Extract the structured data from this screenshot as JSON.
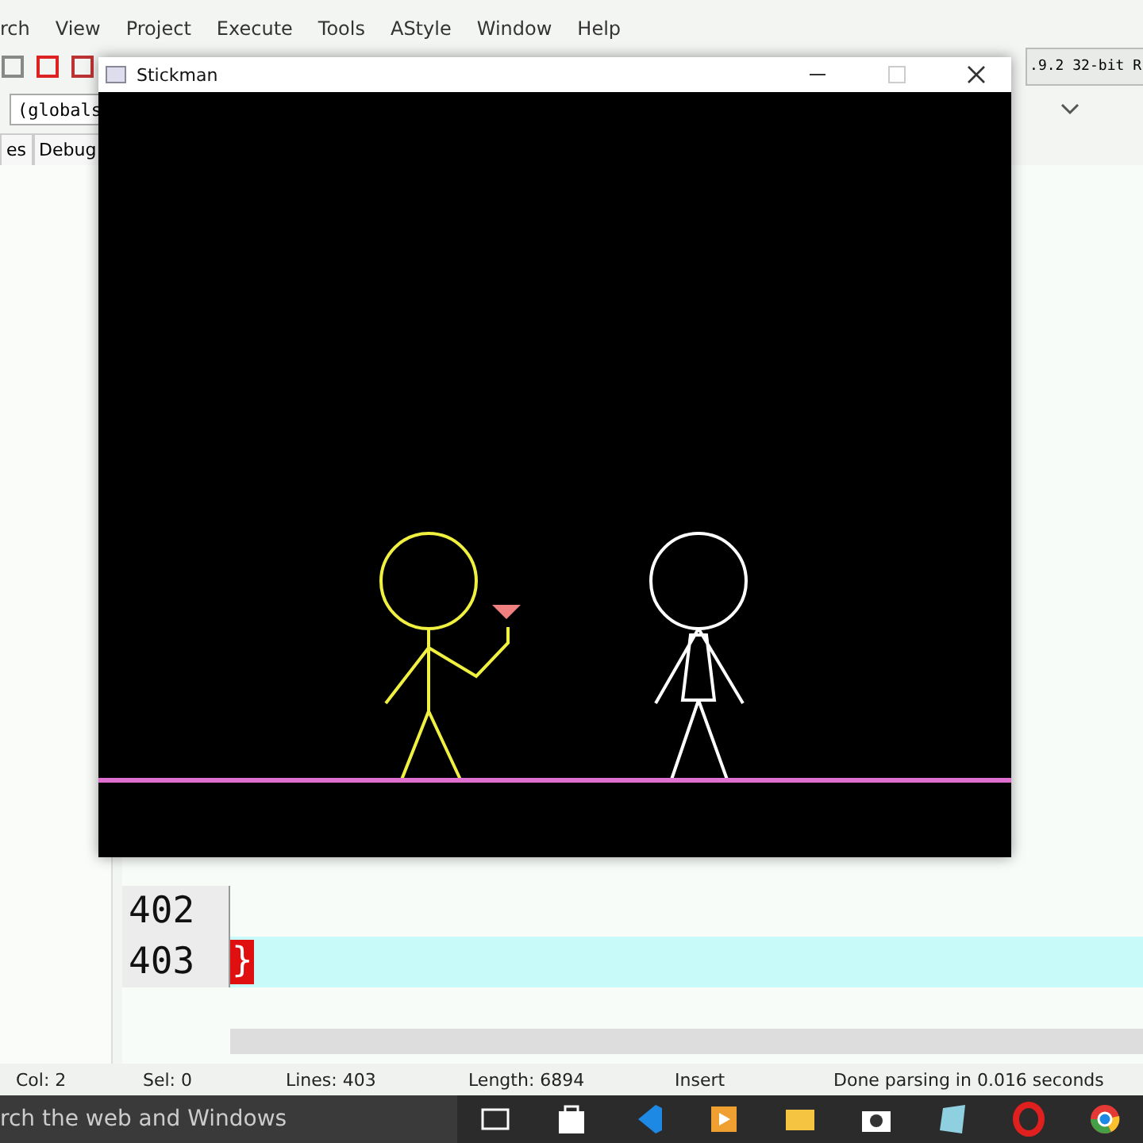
{
  "ide": {
    "menu": [
      "rch",
      "View",
      "Project",
      "Execute",
      "Tools",
      "AStyle",
      "Window",
      "Help"
    ],
    "scope_selector": "(globals",
    "compiler_selector": ".9.2 32-bit R",
    "tabs": [
      "es",
      "Debug"
    ],
    "editor": {
      "lines": [
        {
          "number": "402",
          "current": false
        },
        {
          "number": "403",
          "code": "}",
          "current": true
        }
      ]
    },
    "status_bar": [
      {
        "label": "Col:",
        "value": "2"
      },
      {
        "label": "Sel:",
        "value": "0"
      },
      {
        "label": "Lines:",
        "value": "403"
      },
      {
        "label": "Length:",
        "value": "6894"
      },
      {
        "value": "Insert"
      },
      {
        "value": "Done parsing in 0.016 seconds"
      }
    ]
  },
  "taskbar": {
    "search": "rch the web and Windows"
  },
  "graphics_window": {
    "title": "Stickman"
  }
}
